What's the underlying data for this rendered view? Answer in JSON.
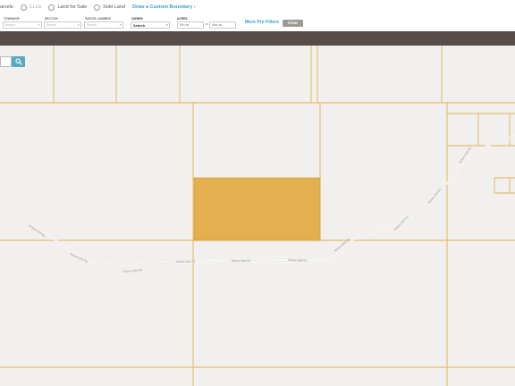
{
  "toggles": {
    "parcels": "arcels",
    "clus": "CLUs",
    "land_for_sale": "Land for Sale",
    "sold_land": "Sold Land"
  },
  "custom_boundary": "Draw a Custom Boundary ›",
  "filters": {
    "township": {
      "label": "TOWNSHIP",
      "value": "Search"
    },
    "section": {
      "label": "SECTION",
      "value": "Search"
    },
    "parcel_number": {
      "label": "PARCEL NUMBER",
      "value": "Search"
    },
    "owner": {
      "label": "OWNER",
      "value": "Search"
    },
    "acres": {
      "label": "ACRES",
      "min_placeholder": "Min ac",
      "to": "to",
      "max_placeholder": "Max ac"
    }
  },
  "more_filters": "More Pro Filters",
  "clear": "Clear",
  "colors": {
    "map_background": "#f2f0ee",
    "parcel_line": "#e2b24a",
    "selected_parcel": "#e2b04f",
    "header_dark": "#564d48",
    "accent": "#3aa4c4"
  },
  "map": {
    "road_labels": [
      "Mckee Bell Rd",
      "Mckee Bell Rd",
      "Mckee Bell Rd",
      "Mckee Bell Rd",
      "Mckee Bell Rd",
      "Mckee Bell Rd",
      "Mckee Bell Rd"
    ],
    "icons": {
      "search": "search-icon"
    }
  }
}
